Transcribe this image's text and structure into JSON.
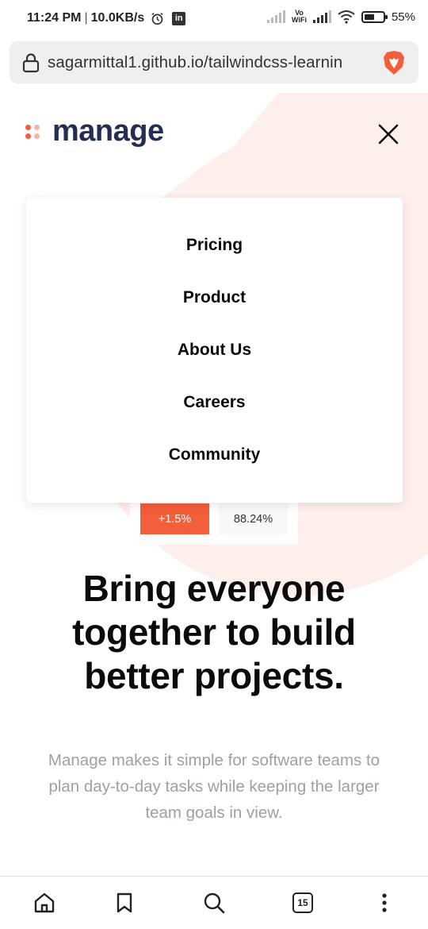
{
  "status_bar": {
    "time": "11:24 PM",
    "speed": "10.0KB/s",
    "linkedin_badge": "in",
    "volte_top": "Vo",
    "volte_bottom": "WiFi",
    "battery": "55%",
    "icons": [
      "alarm-icon",
      "linkedin-icon",
      "signal-icon",
      "volte-wifi-icon",
      "wifi-icon",
      "battery-icon"
    ]
  },
  "browser": {
    "url": "sagarmittal1.github.io/tailwindcss-learnin",
    "tab_count": "15",
    "icons": [
      "lock-icon",
      "brave-icon",
      "home-icon",
      "bookmark-icon",
      "search-icon",
      "tabs-icon",
      "more-icon"
    ]
  },
  "site": {
    "logo_text": "manage",
    "menu": [
      "Pricing",
      "Product",
      "About Us",
      "Careers",
      "Community"
    ],
    "stats": {
      "change": "+1.5%",
      "percent": "88.24%"
    },
    "headline": [
      "Bring everyone",
      "together to build",
      "better projects."
    ],
    "subtext": [
      "Manage makes it simple for software teams to",
      "plan day-to-day tasks while keeping the larger",
      "team goals in view."
    ]
  },
  "colors": {
    "accent": "#f25f3a",
    "brand_dark": "#242d52",
    "bg_tint": "#fdf0ec",
    "muted_text": "#9aa1ab"
  }
}
